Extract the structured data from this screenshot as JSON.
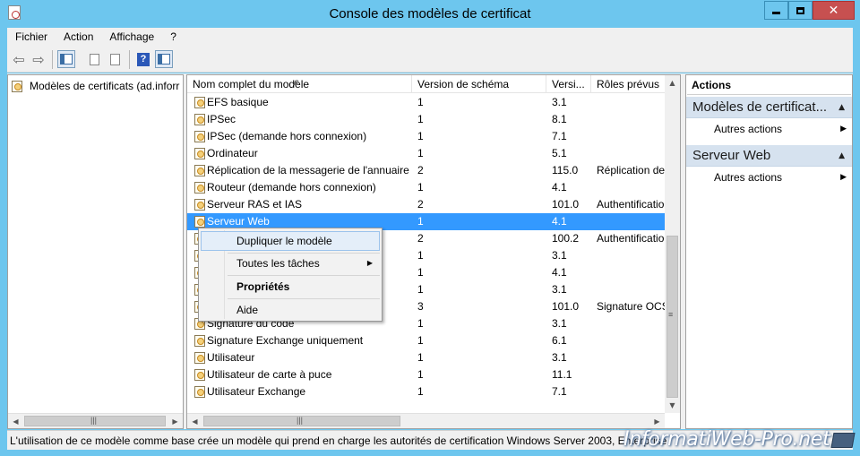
{
  "window": {
    "title": "Console des modèles de certificat",
    "close_glyph": "✕"
  },
  "menu": [
    "Fichier",
    "Action",
    "Affichage",
    "?"
  ],
  "toolbar": {
    "back_icon": "⇦",
    "forward_icon": "⇨",
    "help_glyph": "?"
  },
  "tree": {
    "root_label": "Modèles de certificats (ad.inforr"
  },
  "list": {
    "columns": {
      "name": "Nom complet du modèle",
      "schema": "Version de schéma",
      "version": "Versi...",
      "roles": "Rôles prévus"
    },
    "sort_indicator": "▲",
    "rows": [
      {
        "name": "EFS basique",
        "schema": "1",
        "version": "3.1",
        "roles": ""
      },
      {
        "name": "IPSec",
        "schema": "1",
        "version": "8.1",
        "roles": ""
      },
      {
        "name": "IPSec (demande hors connexion)",
        "schema": "1",
        "version": "7.1",
        "roles": ""
      },
      {
        "name": "Ordinateur",
        "schema": "1",
        "version": "5.1",
        "roles": ""
      },
      {
        "name": "Réplication de la messagerie de l'annuaire",
        "schema": "2",
        "version": "115.0",
        "roles": "Réplication de"
      },
      {
        "name": "Routeur (demande hors connexion)",
        "schema": "1",
        "version": "4.1",
        "roles": ""
      },
      {
        "name": "Serveur RAS et IAS",
        "schema": "2",
        "version": "101.0",
        "roles": "Authentificatio"
      },
      {
        "name": "Serveur Web",
        "schema": "1",
        "version": "4.1",
        "roles": ""
      },
      {
        "name": "",
        "schema": "2",
        "version": "100.2",
        "roles": "Authentificatio"
      },
      {
        "name": "",
        "schema": "1",
        "version": "3.1",
        "roles": ""
      },
      {
        "name": "",
        "schema": "1",
        "version": "4.1",
        "roles": ""
      },
      {
        "name": "",
        "schema": "1",
        "version": "3.1",
        "roles": ""
      },
      {
        "name": "",
        "schema": "3",
        "version": "101.0",
        "roles": "Signature OCS"
      },
      {
        "name": "Signature du code",
        "schema": "1",
        "version": "3.1",
        "roles": ""
      },
      {
        "name": "Signature Exchange uniquement",
        "schema": "1",
        "version": "6.1",
        "roles": ""
      },
      {
        "name": "Utilisateur",
        "schema": "1",
        "version": "3.1",
        "roles": ""
      },
      {
        "name": "Utilisateur de carte à puce",
        "schema": "1",
        "version": "11.1",
        "roles": ""
      },
      {
        "name": "Utilisateur Exchange",
        "schema": "1",
        "version": "7.1",
        "roles": ""
      }
    ],
    "selected_index": 7
  },
  "context_menu": {
    "items": [
      "Dupliquer le modèle",
      "Toutes les tâches",
      "Propriétés",
      "Aide"
    ],
    "submenu_arrow": "▶"
  },
  "actions": {
    "title": "Actions",
    "sections": [
      {
        "title": "Modèles de certificat...",
        "item": "Autres actions"
      },
      {
        "title": "Serveur Web",
        "item": "Autres actions"
      }
    ],
    "collapse_glyph": "▲",
    "more_glyph": "▶"
  },
  "scroll_glyphs": {
    "left": "◀",
    "right": "▶",
    "up": "▲",
    "down": "▼",
    "grip": "|||",
    "grip_v": "≡"
  },
  "status": {
    "text": "L'utilisation de ce modèle comme base crée un modèle qui prend en charge les autorités de certification Windows Server 2003, Enterprise"
  },
  "watermark": "InformatiWeb-Pro.net",
  "colors": {
    "selection": "#3399ff",
    "titlebar": "#6dc6ee",
    "close_button": "#c75050",
    "actions_header": "#d6e2ef"
  }
}
